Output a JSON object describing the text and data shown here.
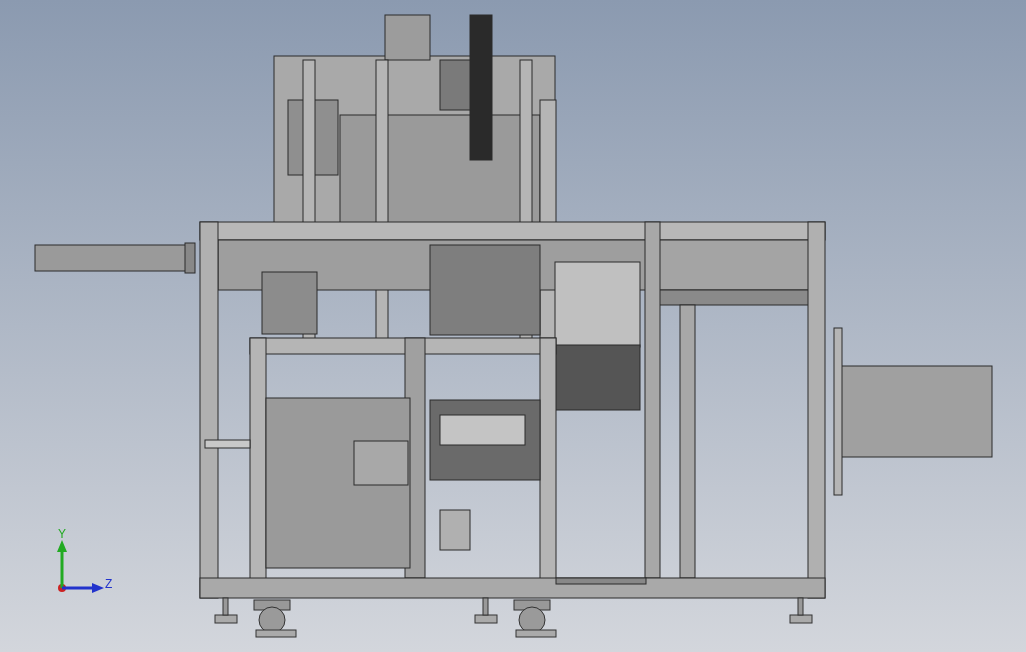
{
  "viewport": {
    "triad": {
      "axes": [
        {
          "label": "Y",
          "kind": "vertical",
          "color": "#22aa22"
        },
        {
          "label": "Z",
          "kind": "horizontal",
          "color": "#2233cc"
        }
      ]
    }
  }
}
